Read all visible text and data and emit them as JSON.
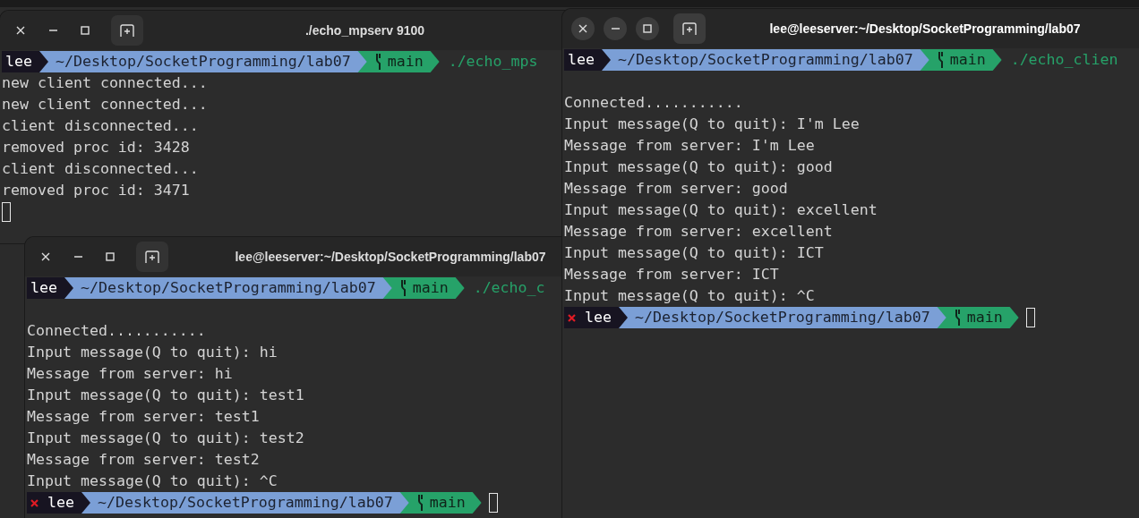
{
  "windows": [
    {
      "title": "./echo_mpserv 9100",
      "focused": false,
      "entries": [
        {
          "kind": "prompt",
          "error": false,
          "user": "lee",
          "path": "~/Desktop/SocketProgramming/lab07",
          "branch": "main",
          "command": "./echo_mps",
          "cursor": false
        },
        {
          "kind": "output",
          "text": "new client connected..."
        },
        {
          "kind": "output",
          "text": "new client connected..."
        },
        {
          "kind": "output",
          "text": "client disconnected..."
        },
        {
          "kind": "output",
          "text": "removed proc id: 3428"
        },
        {
          "kind": "output",
          "text": "client disconnected..."
        },
        {
          "kind": "output",
          "text": "removed proc id: 3471"
        },
        {
          "kind": "cursor"
        }
      ]
    },
    {
      "title": "lee@leeserver:~/Desktop/SocketProgramming/lab07",
      "focused": false,
      "entries": [
        {
          "kind": "prompt",
          "error": false,
          "user": "lee",
          "path": "~/Desktop/SocketProgramming/lab07",
          "branch": "main",
          "command": "./echo_c",
          "cursor": false
        },
        {
          "kind": "blank"
        },
        {
          "kind": "output",
          "text": "Connected..........."
        },
        {
          "kind": "output",
          "text": "Input message(Q to quit): hi"
        },
        {
          "kind": "output",
          "text": "Message from server: hi"
        },
        {
          "kind": "output",
          "text": "Input message(Q to quit): test1"
        },
        {
          "kind": "output",
          "text": "Message from server: test1"
        },
        {
          "kind": "output",
          "text": "Input message(Q to quit): test2"
        },
        {
          "kind": "output",
          "text": "Message from server: test2"
        },
        {
          "kind": "output",
          "text": "Input message(Q to quit): ^C"
        },
        {
          "kind": "prompt",
          "error": true,
          "user": "lee",
          "path": "~/Desktop/SocketProgramming/lab07",
          "branch": "main",
          "cursor": true
        }
      ]
    },
    {
      "title": "lee@leeserver:~/Desktop/SocketProgramming/lab07",
      "focused": true,
      "entries": [
        {
          "kind": "prompt",
          "error": false,
          "user": "lee",
          "path": "~/Desktop/SocketProgramming/lab07",
          "branch": "main",
          "command": "./echo_clien",
          "cursor": false
        },
        {
          "kind": "blank"
        },
        {
          "kind": "output",
          "text": "Connected..........."
        },
        {
          "kind": "output",
          "text": "Input message(Q to quit): I'm Lee"
        },
        {
          "kind": "output",
          "text": "Message from server: I'm Lee"
        },
        {
          "kind": "output",
          "text": "Input message(Q to quit): good"
        },
        {
          "kind": "output",
          "text": "Message from server: good"
        },
        {
          "kind": "output",
          "text": "Input message(Q to quit): excellent"
        },
        {
          "kind": "output",
          "text": "Message from server: excellent"
        },
        {
          "kind": "output",
          "text": "Input message(Q to quit): ICT"
        },
        {
          "kind": "output",
          "text": "Message from server: ICT"
        },
        {
          "kind": "output",
          "text": "Input message(Q to quit): ^C"
        },
        {
          "kind": "prompt",
          "error": true,
          "user": "lee",
          "path": "~/Desktop/SocketProgramming/lab07",
          "branch": "main",
          "cursor": true
        }
      ]
    }
  ]
}
